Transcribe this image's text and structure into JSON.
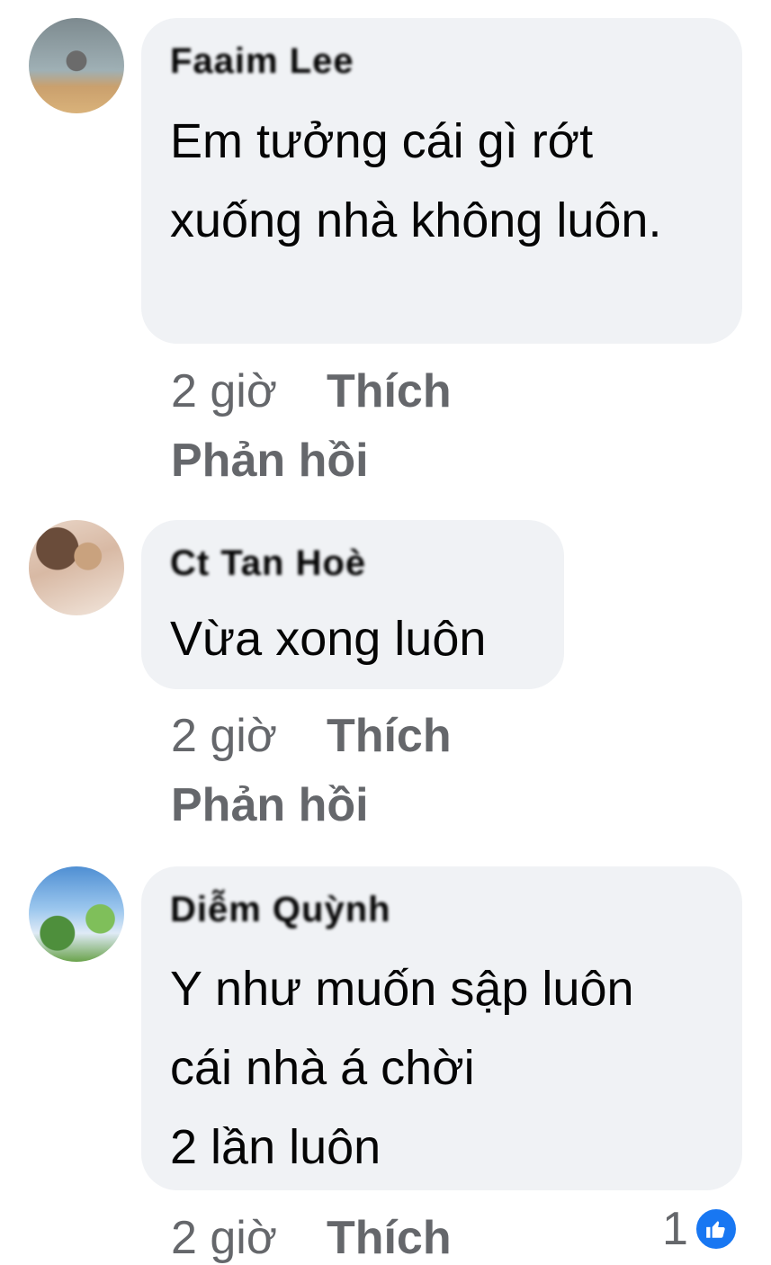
{
  "comments": [
    {
      "author": "Faaim Lee",
      "text": "Em tưởng cái gì rớt xuống nhà không luôn.",
      "time": "2 giờ",
      "like_label": "Thích",
      "reply_label": "Phản hồi"
    },
    {
      "author": "Ct Tan Hoè",
      "text": "Vừa xong luôn",
      "time": "2 giờ",
      "like_label": "Thích",
      "reply_label": "Phản hồi"
    },
    {
      "author": "Diễm Quỳnh",
      "text_lines": [
        "Y như muốn sập luôn",
        "cái nhà á chời",
        "2 lần luôn"
      ],
      "time": "2 giờ",
      "like_label": "Thích",
      "reaction_count": "1",
      "reaction_icon": "thumbs-up-icon"
    }
  ],
  "colors": {
    "bubble": "#f0f2f5",
    "meta_text": "#65676b",
    "like_reaction": "#1877f2"
  }
}
